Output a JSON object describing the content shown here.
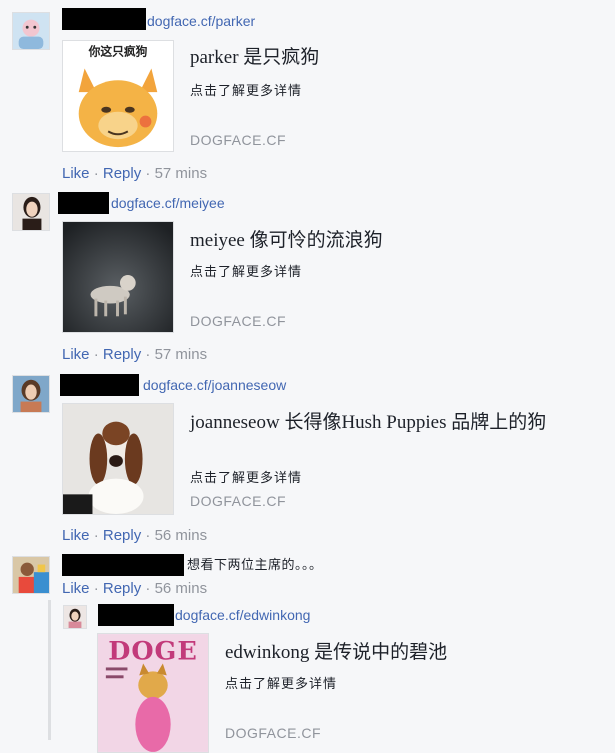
{
  "comments": [
    {
      "link": "dogface.cf/parker",
      "card": {
        "title": "parker 是只疯狗",
        "desc": "点击了解更多详情",
        "domain": "DOGFACE.CF",
        "thumb_caption": "你这只疯狗"
      },
      "actions": {
        "like": "Like",
        "reply": "Reply",
        "sep": "·",
        "time": "57 mins"
      }
    },
    {
      "link": "dogface.cf/meiyee",
      "card": {
        "title": "meiyee 像可怜的流浪狗",
        "desc": "点击了解更多详情",
        "domain": "DOGFACE.CF"
      },
      "actions": {
        "like": "Like",
        "reply": "Reply",
        "sep": "·",
        "time": "57 mins"
      }
    },
    {
      "link": "dogface.cf/joanneseow",
      "card": {
        "title": "joanneseow 长得像Hush Puppies 品牌上的狗",
        "desc": "点击了解更多详情",
        "domain": "DOGFACE.CF"
      },
      "actions": {
        "like": "Like",
        "reply": "Reply",
        "sep": "·",
        "time": "56 mins"
      }
    },
    {
      "text": "想看下两位主席的。。。",
      "actions": {
        "like": "Like",
        "reply": "Reply",
        "sep": "·",
        "time": "56 mins"
      }
    },
    {
      "link": "dogface.cf/edwinkong",
      "card": {
        "title": "edwinkong 是传说中的碧池",
        "desc": "点击了解更多详情",
        "domain": "DOGFACE.CF",
        "thumb_caption": "DOGE"
      }
    }
  ],
  "colors": {
    "link": "#4267b2",
    "meta": "#90949c",
    "text": "#1d2129",
    "background": "#f6f7f9",
    "redaction": "#000000"
  }
}
